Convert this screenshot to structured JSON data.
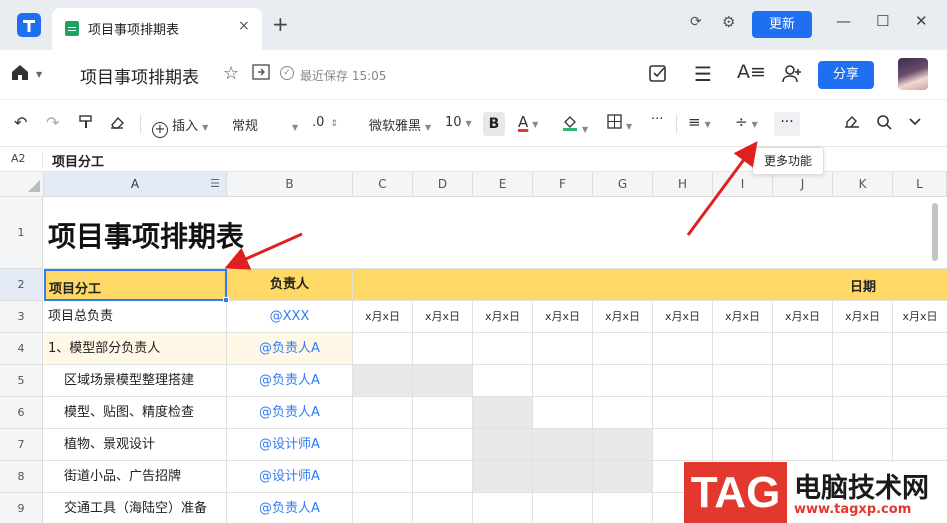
{
  "tab": {
    "label": "项目事项排期表",
    "close": "×",
    "new_tab": "+"
  },
  "window": {
    "update_label": "更新",
    "minimize": "—",
    "maximize": "☐",
    "close": "✕"
  },
  "header": {
    "title": "项目事项排期表",
    "saved": "最近保存 15:05",
    "share_label": "分享"
  },
  "toolbar": {
    "insert": "插入",
    "format": "常规",
    "decimal": ".0",
    "font": "微软雅黑",
    "size": "10",
    "bold": "B",
    "font_color": "A",
    "more": "···",
    "more_tooltip": "更多功能",
    "colors": {
      "font_color_bar": "#e23a2e",
      "fill_color_bar": "#2fb36f"
    }
  },
  "formula_bar": {
    "cell_ref": "A2",
    "value": "项目分工"
  },
  "columns": [
    "A",
    "B",
    "C",
    "D",
    "E",
    "F",
    "G",
    "H",
    "I",
    "J",
    "K",
    "L"
  ],
  "rows": [
    "1",
    "2",
    "3",
    "4",
    "5",
    "6",
    "7",
    "8",
    "9"
  ],
  "sheet": {
    "title": "项目事项排期表",
    "header_row": {
      "a": "项目分工",
      "b": "负责人",
      "date": "日期"
    },
    "row3": {
      "a": "项目总负责",
      "b": "@XXX",
      "dates": [
        "x月x日",
        "x月x日",
        "x月x日",
        "x月x日",
        "x月x日",
        "x月x日",
        "x月x日",
        "x月x日",
        "x月x日",
        "x月x日"
      ]
    },
    "tasks": [
      {
        "a": "1、模型部分负责人",
        "b": "@负责人A"
      },
      {
        "a": "区域场景模型整理搭建",
        "b": "@负责人A"
      },
      {
        "a": "模型、贴图、精度检查",
        "b": "@负责人A"
      },
      {
        "a": "植物、景观设计",
        "b": "@设计师A"
      },
      {
        "a": "街道小品、广告招牌",
        "b": "@设计师A"
      },
      {
        "a": "交通工具（海陆空）准备",
        "b": "@负责人A"
      }
    ]
  },
  "colors": {
    "accent": "#1f6ff2",
    "header_fill": "#ffd966",
    "highlight_fill": "#fff8e6",
    "gray_fill": "#e8e8e8",
    "mention": "#2f7bf5"
  },
  "watermark": {
    "tag": "TAG",
    "name": "电脑技术网",
    "url": "www.tagxp.com"
  }
}
